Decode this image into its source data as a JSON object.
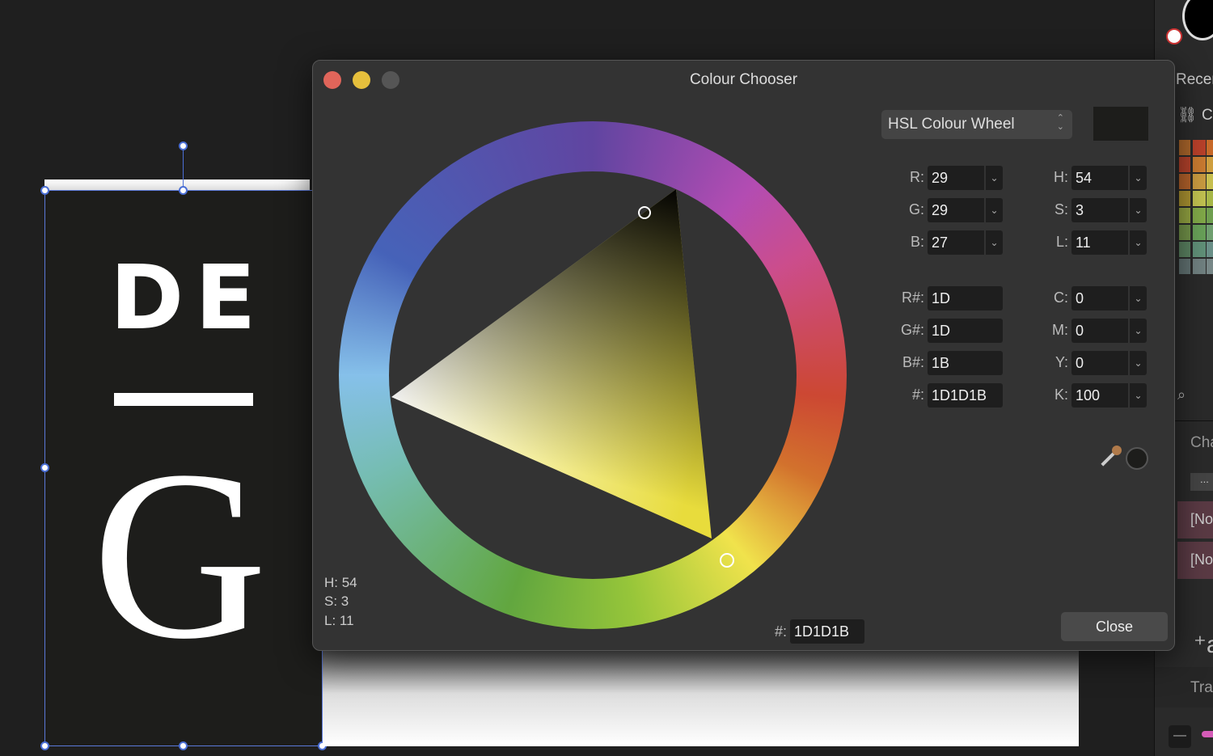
{
  "canvas": {
    "logo_top": "DE",
    "logo_bottom": "G"
  },
  "right_panel": {
    "recent_label": "Recent",
    "colours_label": "Co",
    "chars_label": "Cha",
    "more_label": "...",
    "style1": "[No",
    "style2": "[No",
    "transform_label": "Tra"
  },
  "dialog": {
    "title": "Colour Chooser",
    "mode": "HSL Colour Wheel",
    "current_colour": "#1D1D1B",
    "rgb": [
      {
        "label": "R:",
        "value": "29"
      },
      {
        "label": "G:",
        "value": "29"
      },
      {
        "label": "B:",
        "value": "27"
      }
    ],
    "hsl": [
      {
        "label": "H:",
        "value": "54"
      },
      {
        "label": "S:",
        "value": "3"
      },
      {
        "label": "L:",
        "value": "11"
      }
    ],
    "hex_parts": [
      {
        "label": "R#:",
        "value": "1D"
      },
      {
        "label": "G#:",
        "value": "1D"
      },
      {
        "label": "B#:",
        "value": "1B"
      },
      {
        "label": "#:",
        "value": "1D1D1B"
      }
    ],
    "cmyk": [
      {
        "label": "C:",
        "value": "0"
      },
      {
        "label": "M:",
        "value": "0"
      },
      {
        "label": "Y:",
        "value": "0"
      },
      {
        "label": "K:",
        "value": "100"
      }
    ],
    "readout": {
      "h": "H: 54",
      "s": "S: 3",
      "l": "L: 11"
    },
    "hex_label": "#:",
    "hex_value": "1D1D1B",
    "close_label": "Close",
    "traffic_lights": {
      "close": "#e0655a",
      "minimize": "#e6bf3c",
      "zoom": "#555555"
    }
  }
}
